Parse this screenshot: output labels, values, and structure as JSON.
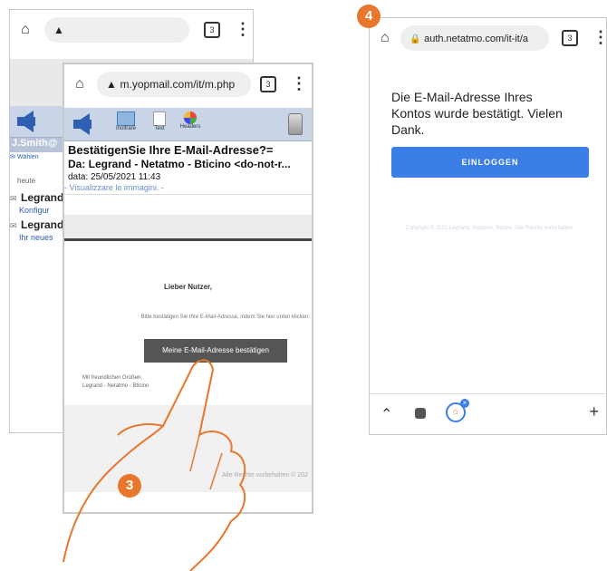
{
  "phone_back": {
    "url": "",
    "sender_short": "J.Smith@",
    "wahlen": "Wählen",
    "heute": "heute",
    "items": [
      {
        "sender": "Legrand",
        "subject": "Konfigur"
      },
      {
        "sender": "Legrand",
        "subject": "Ihr neues"
      }
    ]
  },
  "phone_mail": {
    "url": "m.yopmail.com/it/m.php",
    "toolbar": {
      "inoltrare": "Inoltrare",
      "text": "Text",
      "headers": "Headers"
    },
    "subject": "BestätigenSie Ihre E-Mail-Adresse?=",
    "from": "Da: Legrand - Netatmo - Bticino <do-not-r...",
    "date": "data: 25/05/2021 11:43",
    "show_images": "- Visualizzare le immagini. -",
    "greeting": "Lieber Nutzer,",
    "instruction": "Bitte bestätigen Sie Ihre E-Mail-Adresse, indem Sie hier unten klicken:",
    "confirm_button": "Meine E-Mail-Adresse bestätigen",
    "regards": "Mit freundlichen Grüßen,",
    "signature": "Legrand - Netatmo - Bticino",
    "footer_rights": "Alle Rechte vorbehalten © 202"
  },
  "phone_auth": {
    "url": "auth.netatmo.com/it-it/a",
    "message": "Die E-Mail-Adresse Ihres Kontos wurde bestätigt. Vielen Dank.",
    "login_button": "EINLOGGEN",
    "copyright": "Copyright © 2021 Legrand, Netatmo, Bticino. Alle Rechte vorbehalten."
  },
  "steps": {
    "left": "3",
    "right": "4"
  },
  "colors": {
    "accent": "#e8772e",
    "login_blue": "#3b7ee6",
    "yop_blue": "#2e5fb3"
  }
}
